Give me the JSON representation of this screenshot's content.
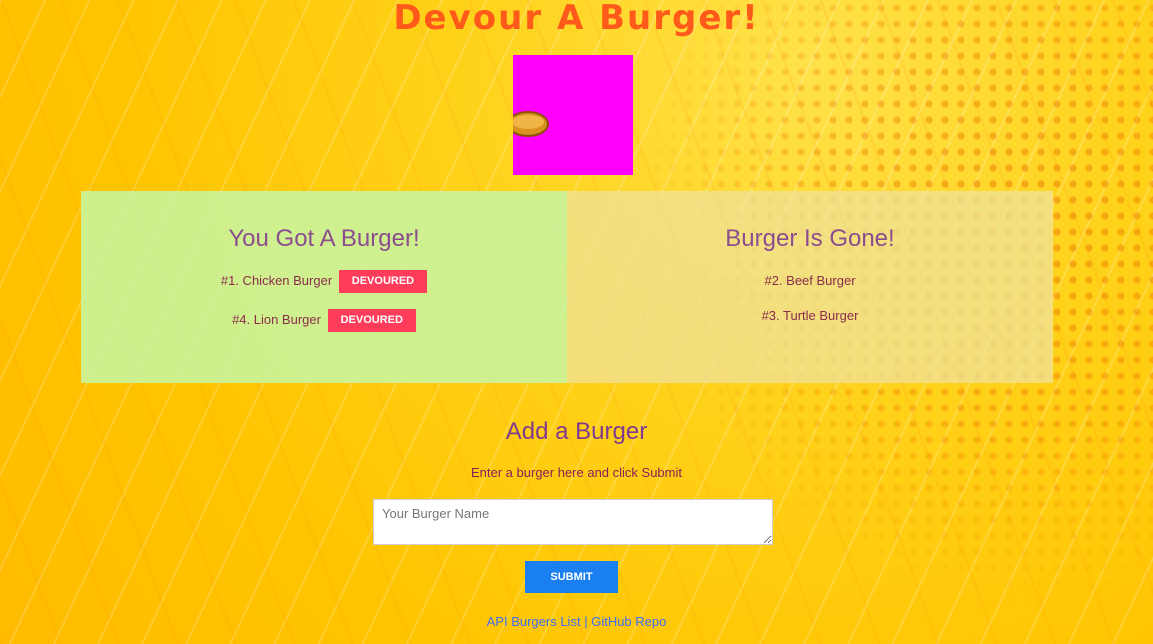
{
  "header": {
    "title": "Devour A Burger!"
  },
  "eaten_panel": {
    "title": "You Got A Burger!",
    "items": [
      {
        "label": "#1. Chicken Burger",
        "button": "DEVOURED"
      },
      {
        "label": "#4. Lion Burger",
        "button": "DEVOURED"
      }
    ]
  },
  "gone_panel": {
    "title": "Burger Is Gone!",
    "items": [
      {
        "label": "#2. Beef Burger"
      },
      {
        "label": "#3. Turtle Burger"
      }
    ]
  },
  "add_form": {
    "title": "Add a Burger",
    "instructions": "Enter a burger here and click Submit",
    "input_placeholder": "Your Burger Name",
    "input_value": "",
    "submit_label": "SUBMIT"
  },
  "footer": {
    "api_link": "API Burgers List",
    "separator": "|",
    "github_link": "GitHub Repo"
  },
  "colors": {
    "title": "#ff5a1a",
    "logo_bg": "#ff00ff",
    "devour_button": "#ff3c5a",
    "submit_button": "#1a7ff0",
    "link": "#3d6ef5"
  }
}
